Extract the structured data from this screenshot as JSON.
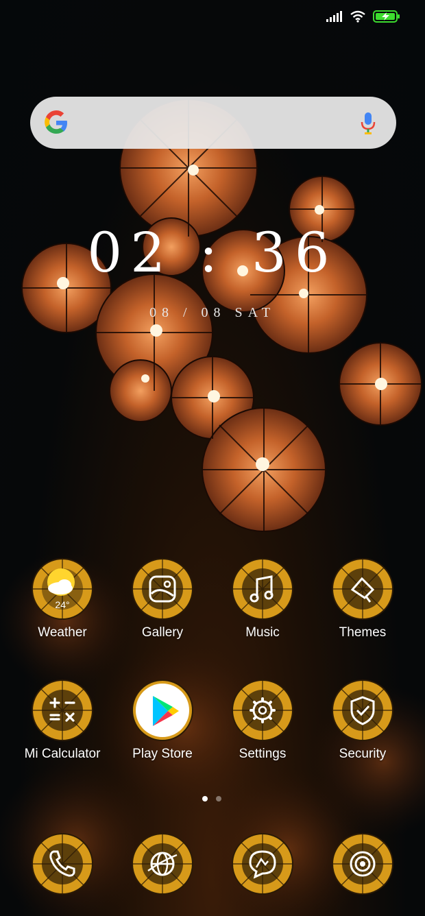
{
  "status_bar": {
    "icons": [
      "signal-icon",
      "wifi-icon",
      "battery-charging-icon"
    ],
    "battery_color": "#3ddc2f"
  },
  "search": {
    "logo": "google-g-icon",
    "mic": "mic-icon"
  },
  "clock": {
    "time": "02 : 36",
    "date": "08 / 08 SAT"
  },
  "apps_row1": [
    {
      "label": "Weather",
      "icon": "weather-icon",
      "badge": "24°"
    },
    {
      "label": "Gallery",
      "icon": "gallery-icon"
    },
    {
      "label": "Music",
      "icon": "music-icon"
    },
    {
      "label": "Themes",
      "icon": "themes-icon"
    }
  ],
  "apps_row2": [
    {
      "label": "Mi Calculator",
      "icon": "calculator-icon"
    },
    {
      "label": "Play Store",
      "icon": "play-store-icon"
    },
    {
      "label": "Settings",
      "icon": "settings-icon"
    },
    {
      "label": "Security",
      "icon": "security-icon"
    }
  ],
  "pages": {
    "count": 2,
    "active": 0
  },
  "dock": [
    {
      "icon": "phone-icon"
    },
    {
      "icon": "browser-icon"
    },
    {
      "icon": "messaging-icon"
    },
    {
      "icon": "camera-icon"
    }
  ],
  "colors": {
    "icon_gold": "#d79a1a",
    "icon_dark": "#2a1a06",
    "lantern": "#c8652a"
  }
}
